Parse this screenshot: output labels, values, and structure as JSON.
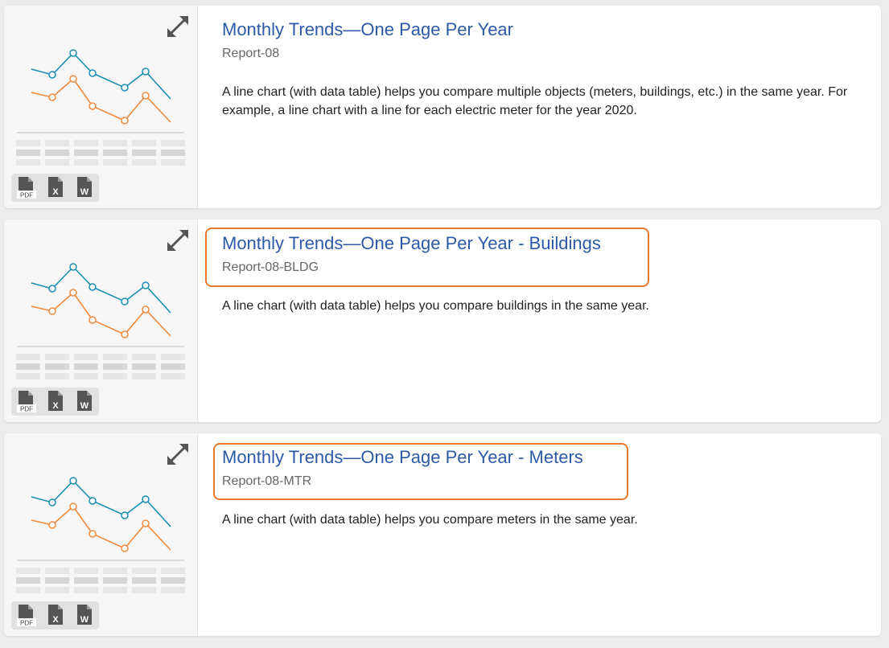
{
  "accent_color": "#2d5aa6",
  "highlight_color": "#e8792b",
  "reports": [
    {
      "title": "Monthly Trends—One Page Per Year",
      "code": "Report-08",
      "description": "A line chart (with data table) helps you compare multiple objects (meters, buildings, etc.) in the same year. For example, a line chart with a line for each electric meter for the year 2020.",
      "highlighted": false
    },
    {
      "title": "Monthly Trends—One Page Per Year - Buildings",
      "code": "Report-08-BLDG",
      "description": "A line chart (with data table) helps you compare buildings in the same year.",
      "highlighted": true
    },
    {
      "title": "Monthly Trends—One Page Per Year - Meters",
      "code": "Report-08-MTR",
      "description": "A line chart (with data table) helps you compare meters in the same year.",
      "highlighted": true
    }
  ],
  "thumbnail": {
    "icons": {
      "expand": "expand-arrows-icon",
      "pdf": "pdf-file-icon",
      "excel": "excel-file-icon",
      "word": "word-file-icon"
    },
    "export_labels": {
      "pdf": "PDF",
      "excel": "X",
      "word": "W"
    },
    "series_colors": [
      "#1b8fb1",
      "#f08a3c"
    ]
  }
}
